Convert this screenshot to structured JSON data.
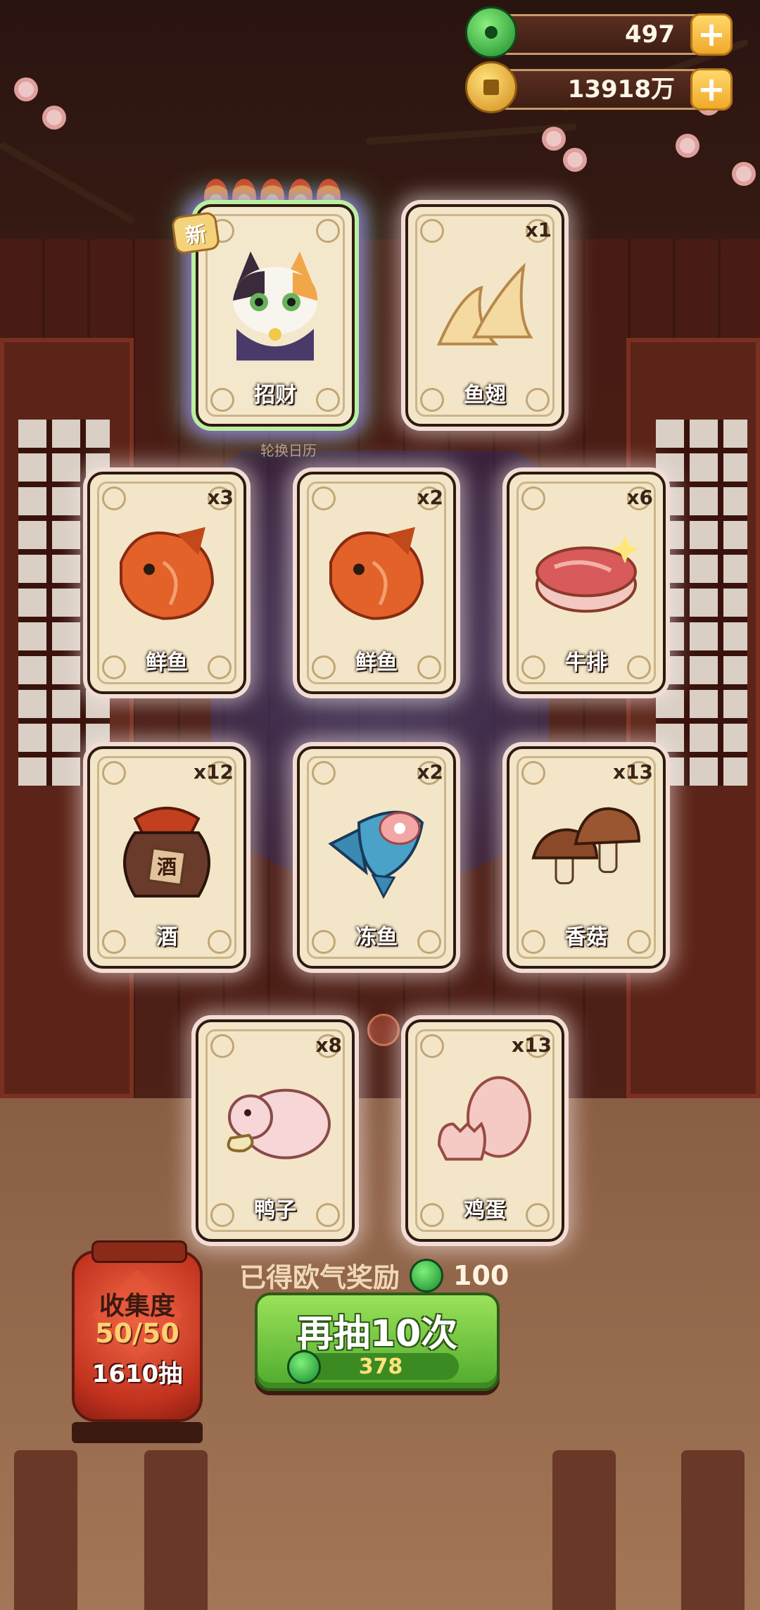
{
  "currency": {
    "jade": {
      "icon": "jade-coin-icon",
      "value": "497",
      "color": "#2fae3a"
    },
    "gold": {
      "icon": "gold-coin-icon",
      "value": "13918万",
      "color": "#f2b632"
    }
  },
  "featured": {
    "flames": 5,
    "new_label": "新",
    "cards": [
      {
        "name": "招财",
        "count": "",
        "art": "calico-cat-wizard",
        "rare": true
      },
      {
        "name": "鱼翅",
        "count": "x1",
        "art": "shark-fin-icon",
        "rare": false
      }
    ]
  },
  "rotate_label": "轮换日历",
  "grid": {
    "row1": [
      {
        "name": "鲜鱼",
        "count": "x3",
        "art": "fish-icon"
      },
      {
        "name": "鲜鱼",
        "count": "x2",
        "art": "fish-icon"
      },
      {
        "name": "牛排",
        "count": "x6",
        "art": "steak-icon"
      }
    ],
    "row2": [
      {
        "name": "酒",
        "count": "x12",
        "art": "wine-jar-icon",
        "jar_label": "酒"
      },
      {
        "name": "冻鱼",
        "count": "x2",
        "art": "frozen-fish-icon"
      },
      {
        "name": "香菇",
        "count": "x13",
        "art": "mushroom-icon"
      }
    ],
    "row3": [
      {
        "name": "鸭子",
        "count": "x8",
        "art": "duck-icon"
      },
      {
        "name": "鸡蛋",
        "count": "x13",
        "art": "egg-icon"
      }
    ]
  },
  "reward": {
    "label": "已得欧气奖励",
    "amount": "100"
  },
  "draw_button": {
    "label": "再抽10次",
    "cost": "378"
  },
  "collection": {
    "title": "收集度",
    "progress": "50/50",
    "draws": "1610抽"
  }
}
